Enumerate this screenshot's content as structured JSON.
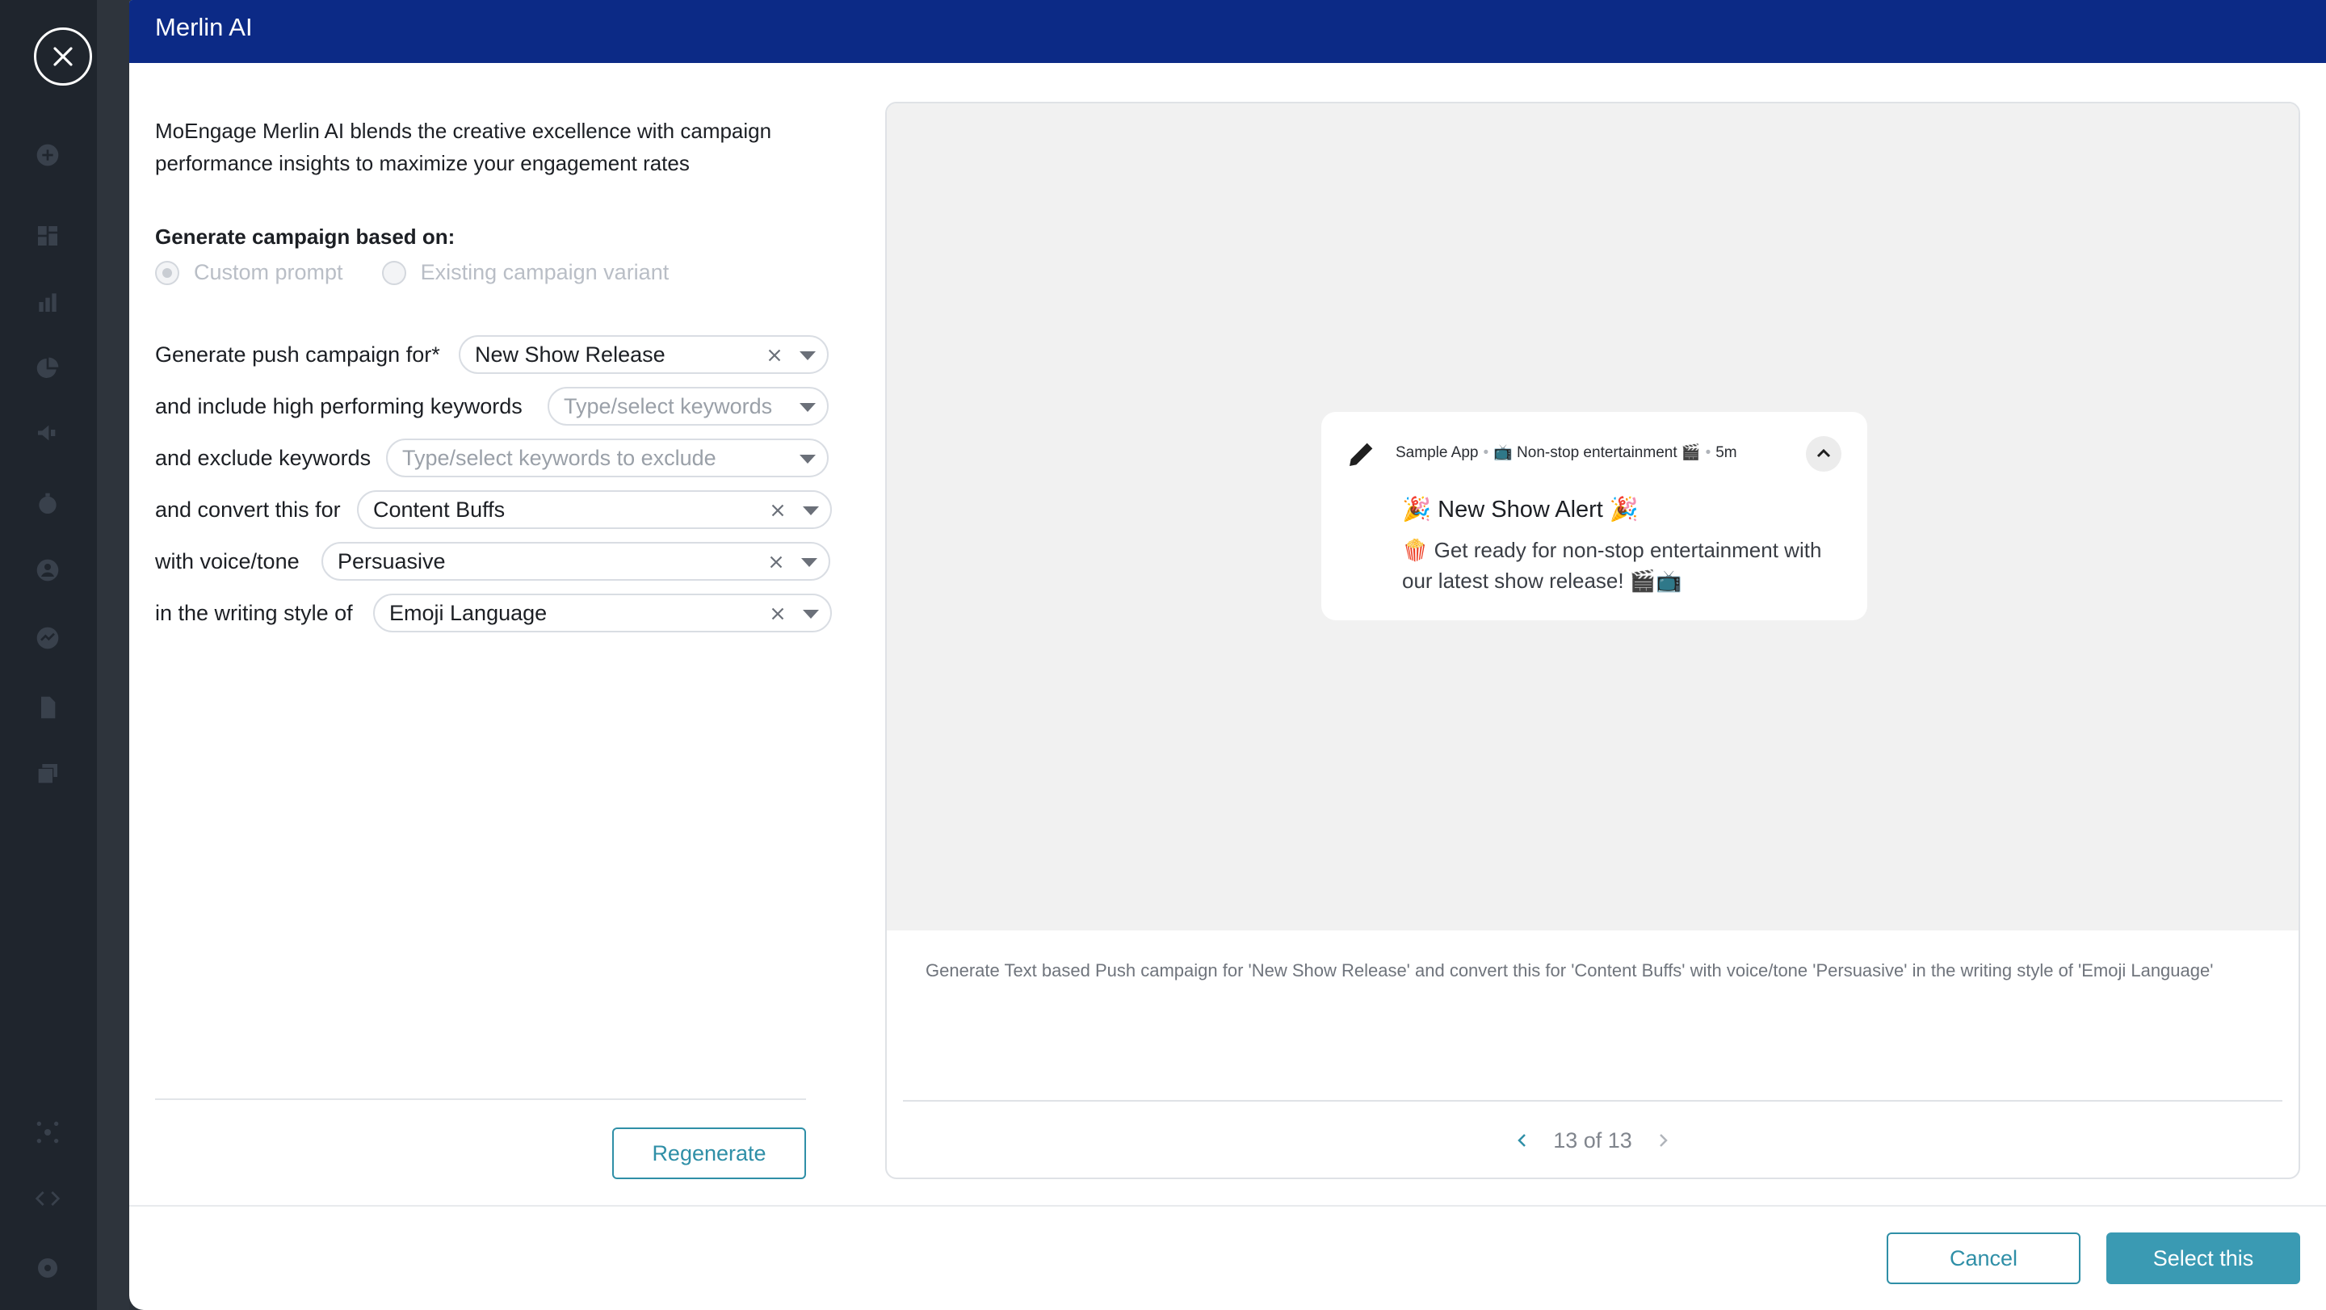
{
  "drawer": {
    "title": "Merlin AI"
  },
  "intro": "MoEngage Merlin AI blends the creative excellence with campaign performance insights to maximize your engagement rates",
  "generate": {
    "label": "Generate campaign based on:",
    "options": [
      {
        "label": "Custom prompt",
        "selected": true
      },
      {
        "label": "Existing campaign variant",
        "selected": false
      }
    ]
  },
  "fields": {
    "push": {
      "label": "Generate push campaign for*",
      "value": "New Show Release"
    },
    "include": {
      "label": "and include high performing keywords",
      "placeholder": "Type/select keywords"
    },
    "exclude": {
      "label": "and exclude keywords",
      "placeholder": "Type/select keywords to exclude"
    },
    "convert": {
      "label": "and convert this for",
      "value": "Content Buffs"
    },
    "voice": {
      "label": "with voice/tone",
      "value": "Persuasive"
    },
    "style": {
      "label": "in the writing style of",
      "value": "Emoji Language"
    }
  },
  "buttons": {
    "regenerate": "Regenerate",
    "cancel": "Cancel",
    "select": "Select this"
  },
  "preview": {
    "notification": {
      "app": "Sample App",
      "channel": "📺 Non-stop entertainment 🎬",
      "time": "5m",
      "title": "🎉 New Show Alert 🎉",
      "body": "🍿 Get ready for non-stop entertainment with our latest show release! 🎬📺"
    },
    "prompt": "Generate Text based Push campaign for 'New Show Release' and convert this for 'Content Buffs' with voice/tone 'Persuasive' in the writing style of 'Emoji Language'",
    "pager": "13 of 13"
  },
  "colors": {
    "header": "#0c2a86",
    "accent": "#2f8fa7",
    "primary_button": "#3a9ab3"
  }
}
